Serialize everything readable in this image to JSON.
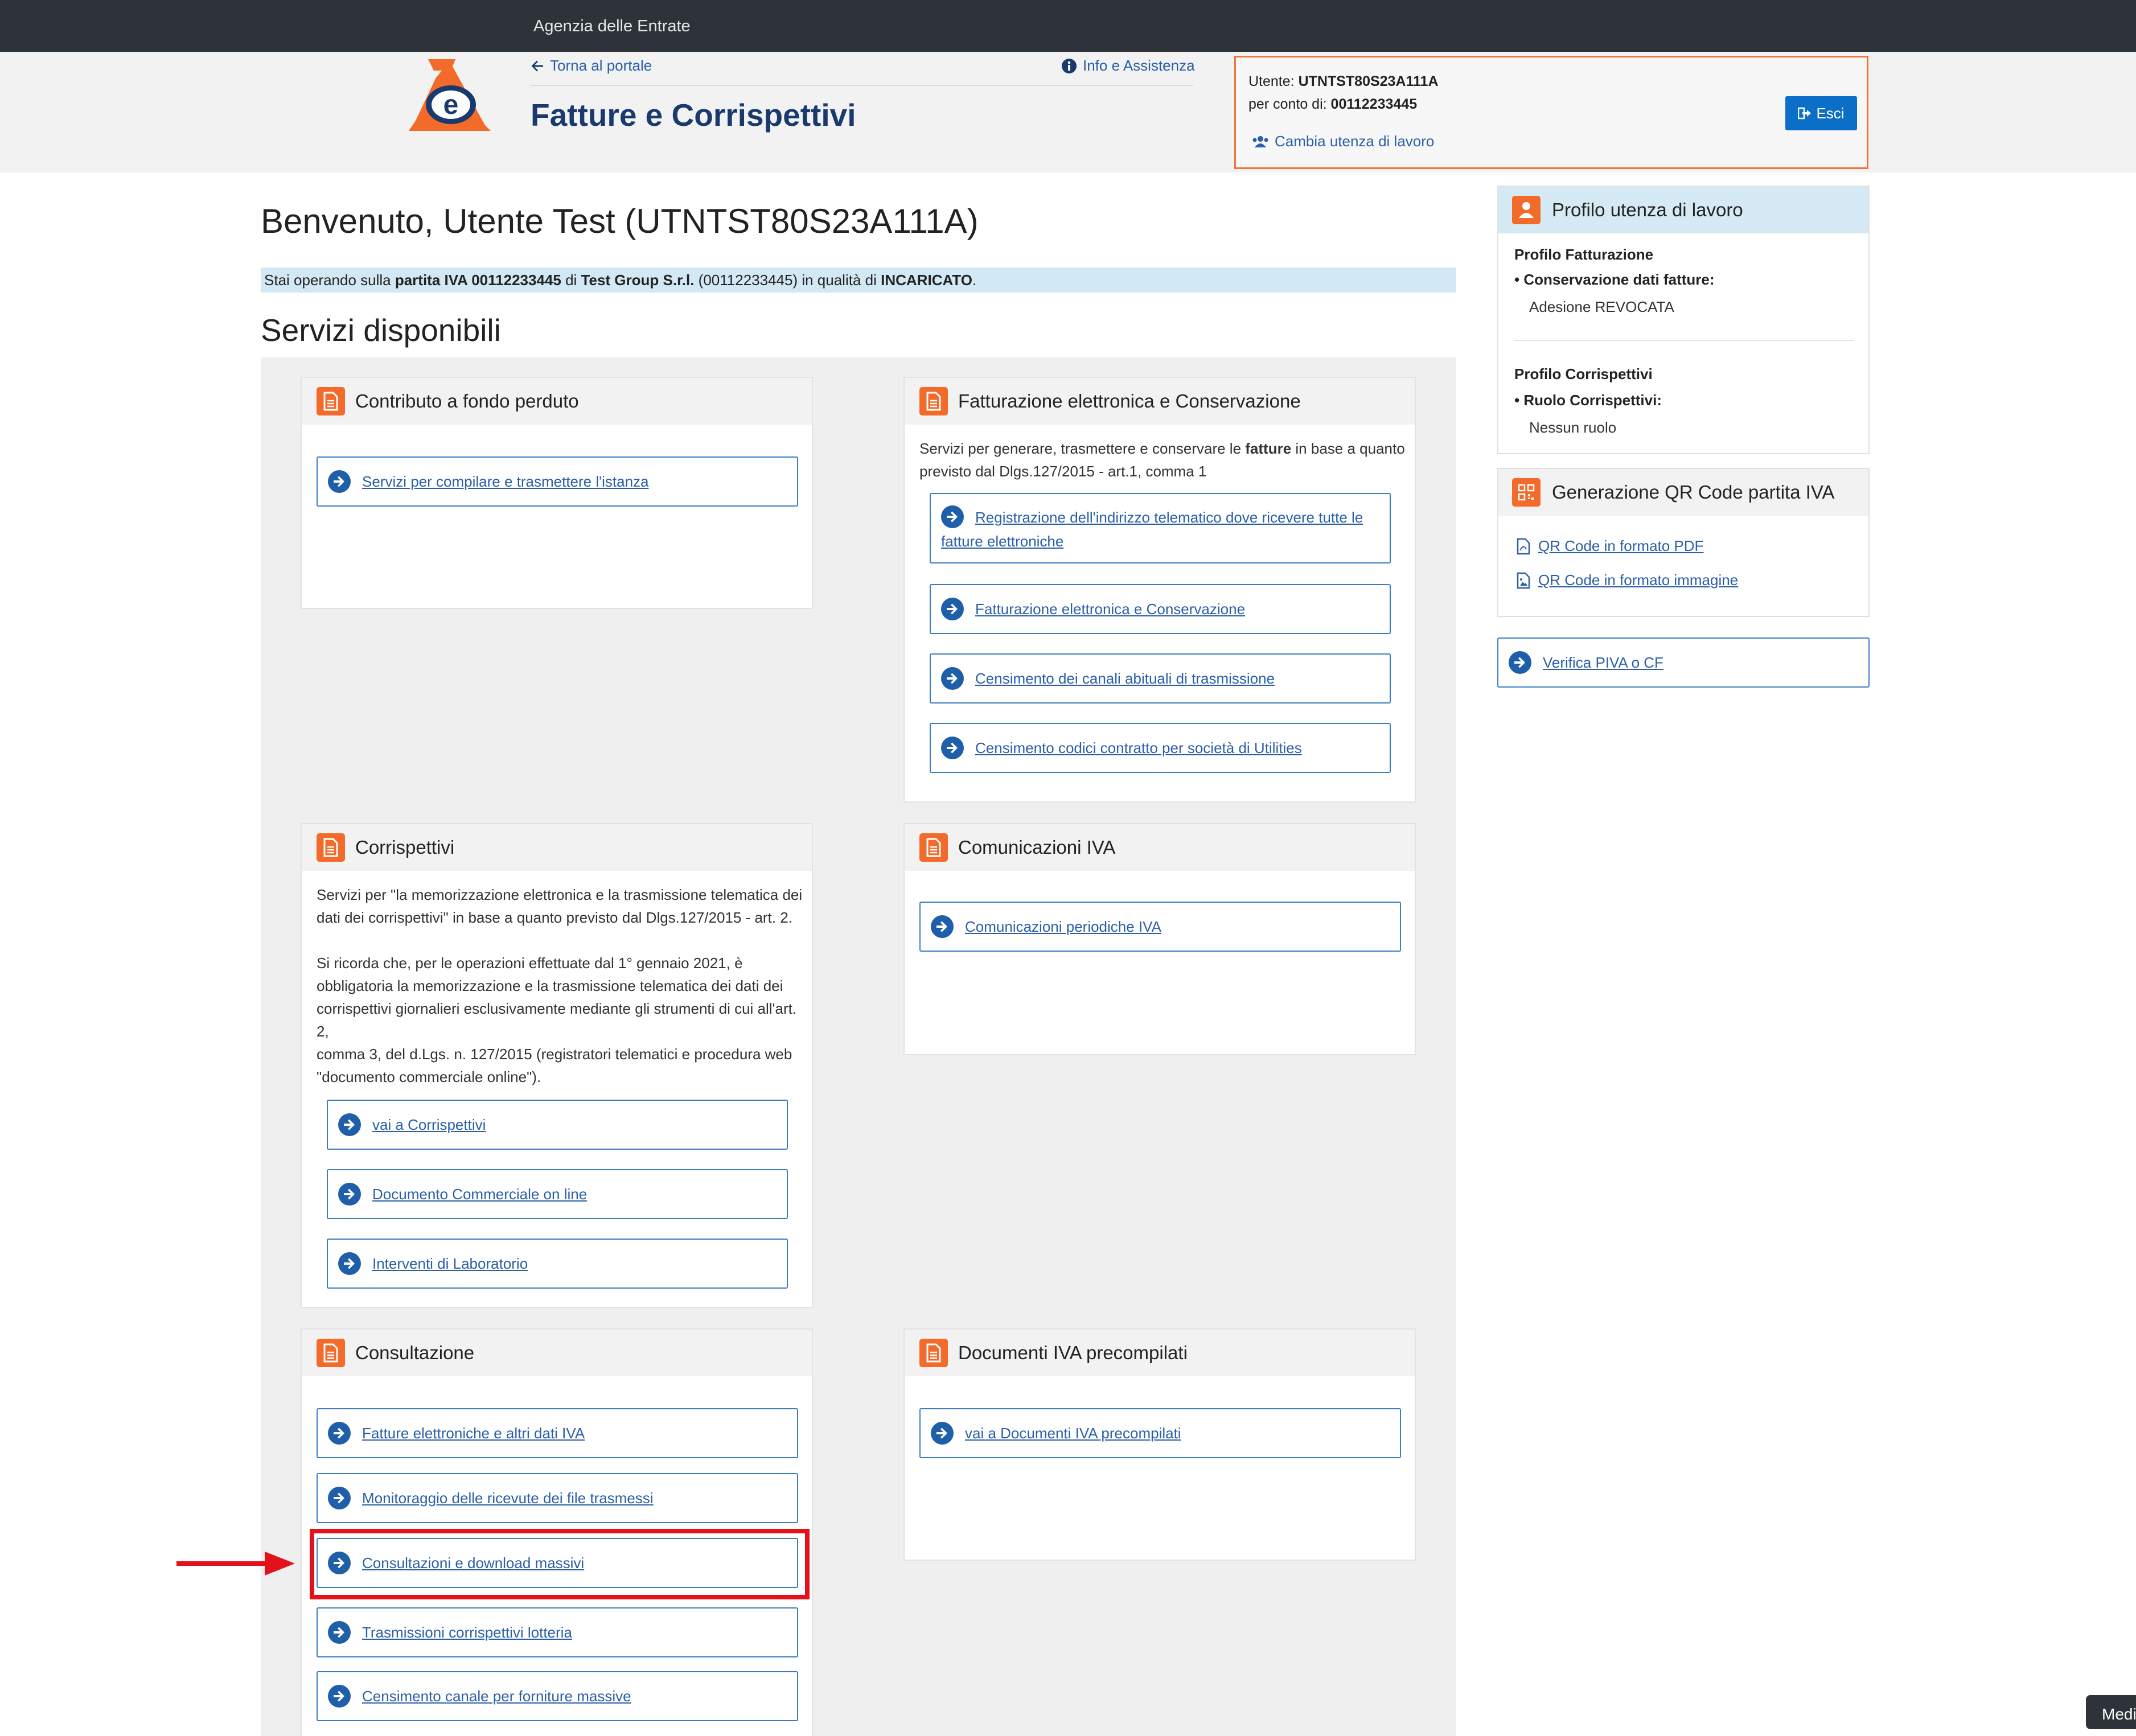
{
  "topbar": {
    "agency": "Agenzia delle Entrate"
  },
  "header": {
    "back_link": "Torna al portale",
    "info_link": "Info e Assistenza",
    "app_title": "Fatture e Corrispettivi"
  },
  "user": {
    "user_label": "Utente:",
    "user_id": "UTNTST80S23A111A",
    "on_behalf_label": "per conto di:",
    "on_behalf_id": "00112233445",
    "change_link": "Cambia utenza di lavoro",
    "logout": "Esci"
  },
  "welcome": "Benvenuto, Utente Test (UTNTST80S23A111A)",
  "operating": {
    "p1": "Stai operando sulla",
    "b1": "partita IVA 00112233445",
    "p2": "di",
    "b2": "Test Group S.r.l.",
    "p3": "(00112233445) in qualità di",
    "b3": "INCARICATO",
    "p4": "."
  },
  "services_title": "Servizi disponibili",
  "cards": {
    "contributo": {
      "title": "Contributo a fondo perduto",
      "links": [
        "Servizi per compilare e trasmettere l'istanza"
      ]
    },
    "fatturazione": {
      "title": "Fatturazione elettronica e Conservazione",
      "desc_1": "Servizi per generare, trasmettere e conservare le",
      "desc_bold": "fatture",
      "desc_2": "in base a quanto",
      "desc_3": "previsto dal Dlgs.127/2015 - art.1, comma 1",
      "link_reg_1": "Registrazione dell'indirizzo telematico dove ricevere tutte le",
      "link_reg_2": "fatture elettroniche",
      "links": [
        "Fatturazione elettronica e Conservazione",
        "Censimento dei canali abituali di trasmissione",
        "Censimento codici contratto per società di Utilities"
      ]
    },
    "corrispettivi": {
      "title": "Corrispettivi",
      "text_lines": [
        "Servizi per \"la memorizzazione elettronica e la trasmissione telematica dei",
        "dati dei corrispettivi\" in base a quanto previsto dal Dlgs.127/2015 - art. 2.",
        "",
        "Si ricorda che, per le operazioni effettuate dal 1° gennaio 2021, è",
        "obbligatoria la memorizzazione e la trasmissione telematica dei dati dei",
        "corrispettivi giornalieri esclusivamente mediante gli strumenti di cui all'art. 2,",
        "comma 3, del d.Lgs. n. 127/2015 (registratori telematici e procedura web",
        "\"documento commerciale online\")."
      ],
      "links": [
        "vai a Corrispettivi",
        "Documento Commerciale on line",
        "Interventi di Laboratorio"
      ]
    },
    "comunicazioni": {
      "title": "Comunicazioni IVA",
      "links": [
        "Comunicazioni periodiche IVA"
      ]
    },
    "consultazione": {
      "title": "Consultazione",
      "links": [
        "Fatture elettroniche e altri dati IVA",
        "Monitoraggio delle ricevute dei file trasmessi",
        "Consultazioni e download massivi",
        "Trasmissioni corrispettivi lotteria",
        "Censimento canale per forniture massive"
      ]
    },
    "documenti": {
      "title": "Documenti IVA precompilati",
      "links": [
        "vai a Documenti IVA precompilati"
      ]
    }
  },
  "sidebar": {
    "profile_title": "Profilo utenza di lavoro",
    "fatt_label": "Profilo Fatturazione",
    "fatt_item": "Conservazione dati fatture:",
    "fatt_value": "Adesione REVOCATA",
    "corr_label": "Profilo Corrispettivi",
    "corr_item": "Ruolo Corrispettivi:",
    "corr_value": "Nessun ruolo",
    "qr_title": "Generazione QR Code partita IVA",
    "qr_pdf": "QR Code in formato PDF",
    "qr_img": "QR Code in formato immagine",
    "verify": "Verifica PIVA o CF"
  },
  "chat_tab": "Medi",
  "colors": {
    "accent_orange": "#f26b2a",
    "brand_blue": "#1a3a6e",
    "link_blue": "#2b5fa8",
    "highlight_red": "#e3121a"
  },
  "icons": {
    "back": "arrow-left-icon",
    "info": "info-circle-icon",
    "users": "users-icon",
    "logout": "sign-out-icon",
    "card": "document-icon",
    "link": "circle-arrow-right-icon",
    "profile": "user-icon",
    "qr": "qr-code-icon",
    "pdf": "pdf-file-icon",
    "image": "image-file-icon"
  }
}
